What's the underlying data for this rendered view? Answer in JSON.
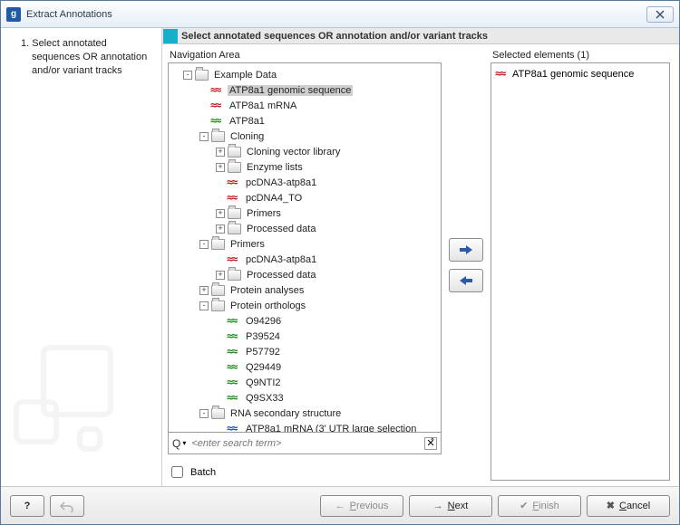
{
  "window": {
    "title": "Extract Annotations"
  },
  "step": "1.  Select annotated sequences OR annotation and/or variant tracks",
  "header": "Select annotated sequences OR annotation and/or variant tracks",
  "nav_label": "Navigation Area",
  "selected_label": "Selected elements (1)",
  "search_placeholder": "<enter search term>",
  "batch_label": "Batch",
  "buttons": {
    "previous": "Previous",
    "next": "Next",
    "finish": "Finish",
    "cancel": "Cancel"
  },
  "selected_items": [
    {
      "icon": "dna-red",
      "label": "ATP8a1 genomic sequence"
    }
  ],
  "tree": [
    {
      "d": 0,
      "exp": "-",
      "icon": "folder",
      "label": "Example Data"
    },
    {
      "d": 1,
      "exp": "",
      "icon": "dna-red",
      "label": "ATP8a1 genomic sequence",
      "selected": true
    },
    {
      "d": 1,
      "exp": "",
      "icon": "dna-red",
      "label": "ATP8a1 mRNA"
    },
    {
      "d": 1,
      "exp": "",
      "icon": "dna-green",
      "label": "ATP8a1"
    },
    {
      "d": 1,
      "exp": "-",
      "icon": "folder",
      "label": "Cloning"
    },
    {
      "d": 2,
      "exp": "+",
      "icon": "folder",
      "label": "Cloning vector library"
    },
    {
      "d": 2,
      "exp": "+",
      "icon": "folder",
      "label": "Enzyme lists"
    },
    {
      "d": 2,
      "exp": "",
      "icon": "dna-red",
      "label": "pcDNA3-atp8a1"
    },
    {
      "d": 2,
      "exp": "",
      "icon": "dna-red",
      "label": "pcDNA4_TO"
    },
    {
      "d": 2,
      "exp": "+",
      "icon": "folder",
      "label": "Primers"
    },
    {
      "d": 2,
      "exp": "+",
      "icon": "folder",
      "label": "Processed data"
    },
    {
      "d": 1,
      "exp": "-",
      "icon": "folder",
      "label": "Primers"
    },
    {
      "d": 2,
      "exp": "",
      "icon": "dna-red",
      "label": "pcDNA3-atp8a1"
    },
    {
      "d": 2,
      "exp": "+",
      "icon": "folder",
      "label": "Processed data"
    },
    {
      "d": 1,
      "exp": "+",
      "icon": "folder",
      "label": "Protein analyses"
    },
    {
      "d": 1,
      "exp": "-",
      "icon": "folder",
      "label": "Protein orthologs"
    },
    {
      "d": 2,
      "exp": "",
      "icon": "dna-green",
      "label": "O94296"
    },
    {
      "d": 2,
      "exp": "",
      "icon": "dna-green",
      "label": "P39524"
    },
    {
      "d": 2,
      "exp": "",
      "icon": "dna-green",
      "label": "P57792"
    },
    {
      "d": 2,
      "exp": "",
      "icon": "dna-green",
      "label": "Q29449"
    },
    {
      "d": 2,
      "exp": "",
      "icon": "dna-green",
      "label": "Q9NTI2"
    },
    {
      "d": 2,
      "exp": "",
      "icon": "dna-green",
      "label": "Q9SX33"
    },
    {
      "d": 1,
      "exp": "-",
      "icon": "folder",
      "label": "RNA secondary structure"
    },
    {
      "d": 2,
      "exp": "",
      "icon": "dna-blue",
      "label": "ATP8a1 mRNA (3' UTR large selection"
    }
  ]
}
